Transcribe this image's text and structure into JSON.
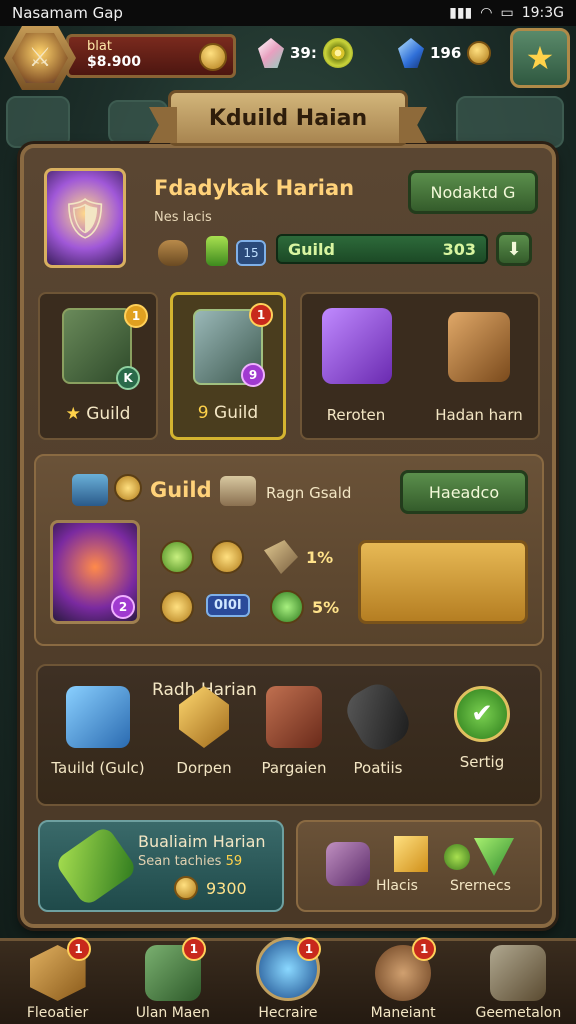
{
  "status_bar": {
    "title": "Nasamam Gap",
    "time": "19:3G"
  },
  "player": {
    "name": "blat",
    "gold": "$8.900"
  },
  "resources": [
    {
      "icon": "crystal-icon",
      "value": "39:"
    },
    {
      "icon": "blue-gem-icon",
      "value": "196"
    }
  ],
  "banner": {
    "title": "Kduild Haian"
  },
  "hero": {
    "name": "Fdadykak Harian",
    "subtitle": "Nes lacis",
    "button_label": "Nodaktd G",
    "bar_label": "Guild",
    "bar_value": "303",
    "chip_value": "15"
  },
  "tabs": [
    {
      "label": "Guild",
      "badge": "1",
      "extra": "K",
      "prefix": "★"
    },
    {
      "label": "Guild",
      "badge": "1",
      "extra": "9",
      "prefix": "9"
    },
    {
      "label": "Reroten"
    },
    {
      "label": "Hadan harn"
    }
  ],
  "section3": {
    "title": "Guild",
    "subtitle": "Ragn Gsald",
    "button_label": "Haeadco",
    "portrait_badge": "2",
    "stats": [
      {
        "icon": "green-scroll-icon",
        "value": ""
      },
      {
        "icon": "gold-disc-icon",
        "value": ""
      },
      {
        "icon": "ore-icon",
        "value": "1%"
      },
      {
        "icon": "gold-coin-icon",
        "value": ""
      },
      {
        "icon": "chip-icon",
        "value": "0I0I"
      },
      {
        "icon": "green-gem-icon",
        "value": "5%"
      }
    ]
  },
  "section4": {
    "title": "Radh Harian",
    "items": [
      {
        "label": "Tauild (Gulc)"
      },
      {
        "label": "Dorpen"
      },
      {
        "label": "Pargaien"
      },
      {
        "label": "Poatiis"
      },
      {
        "label": "Sertig"
      }
    ]
  },
  "section5": {
    "title": "Bualiaim Harian",
    "subtitle": "Sean tachies",
    "subtitle_value": "59",
    "price": "9300",
    "right_labels": [
      "Hlacis",
      "Srernecs"
    ]
  },
  "nav": [
    {
      "label": "Fleoatier",
      "badge": "1"
    },
    {
      "label": "Ulan Maen",
      "badge": "1"
    },
    {
      "label": "Hecraire",
      "badge": "1"
    },
    {
      "label": "Maneiant",
      "badge": "1"
    },
    {
      "label": "Geemetalon",
      "badge": ""
    }
  ],
  "colors": {
    "accent_gold": "#ffd27a",
    "accent_green": "#5b8f4c",
    "frame": "#8a6a42",
    "badge_red": "#c8291c"
  }
}
